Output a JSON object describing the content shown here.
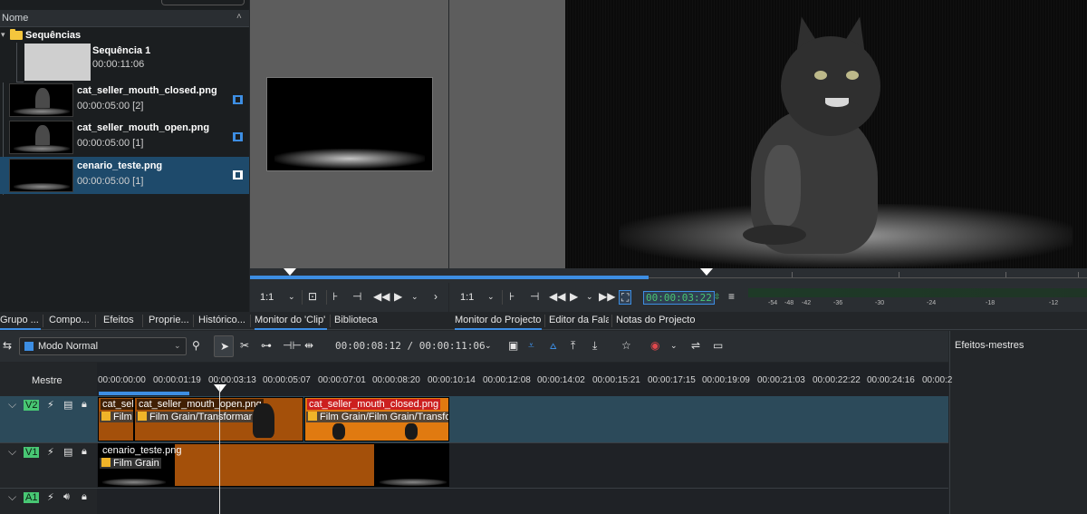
{
  "bin": {
    "header": "Nome",
    "folder": "Sequências",
    "sequence": {
      "name": "Sequência 1",
      "duration": "00:00:11:06"
    },
    "clips": [
      {
        "name": "cat_seller_mouth_closed.png",
        "info": "00:00:05:00 [2]"
      },
      {
        "name": "cat_seller_mouth_open.png",
        "info": "00:00:05:00 [1]"
      },
      {
        "name": "cenario_teste.png",
        "info": "00:00:05:00 [1]"
      }
    ]
  },
  "clip_monitor": {
    "zoom": "1:1"
  },
  "project_monitor": {
    "zoom": "1:1",
    "timecode": "00:00:03:22"
  },
  "audio_meter": [
    "-54",
    "-48",
    "-42",
    "-36",
    "-30",
    "-24",
    "-18",
    "-12"
  ],
  "tabs": [
    "Grupo ...",
    "Compo...",
    "Efeitos",
    "Proprie...",
    "Histórico...",
    "Monitor do 'Clip'",
    "Biblioteca",
    "Monitor do Projecto",
    "Editor da Fala",
    "Notas do Projecto"
  ],
  "timeline": {
    "mode": "Modo Normal",
    "position": "00:00:08:12 / 00:00:11:06",
    "master_label": "Mestre",
    "ruler": [
      "00:00:00:00",
      "00:00:01:19",
      "00:00:03:13",
      "00:00:05:07",
      "00:00:07:01",
      "00:00:08:20",
      "00:00:10:14",
      "00:00:12:08",
      "00:00:14:02",
      "00:00:15:21",
      "00:00:17:15",
      "00:00:19:09",
      "00:00:21:03",
      "00:00:22:22",
      "00:00:24:16",
      "00:00:2"
    ],
    "tracks": {
      "v2": "V2",
      "v1": "V1",
      "a1": "A1"
    },
    "clips": {
      "v2_a": {
        "label": "cat_seller",
        "fx": "Film"
      },
      "v2_b": {
        "label": "cat_seller_mouth_open.png",
        "fx": "Film Grain/Transformar"
      },
      "v2_c": {
        "label": "cat_seller_mouth_closed.png",
        "fx": "Film Grain/Film Grain/Transforr"
      },
      "v1_a": {
        "label": "cenario_teste.png",
        "fx": "Film Grain"
      }
    }
  },
  "master_effects": "Efeitos-mestres",
  "colors": {
    "accent": "#3d8ee3",
    "clip_orange": "#e07a10",
    "clip_brown": "#a4500a",
    "timecode_green": "#48c774"
  }
}
